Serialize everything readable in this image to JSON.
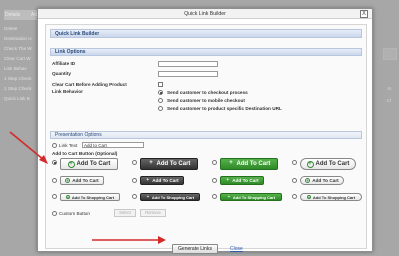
{
  "background": {
    "tabs": [
      "Details",
      "Ad"
    ],
    "sidebar_items": [
      "Delete",
      "Destination U",
      "Check The W",
      "Clear Cart W",
      "Link Behav",
      "1 Step Check",
      "1 Step Check",
      "Quick Link B"
    ],
    "right_links": [
      "st",
      "Cl"
    ]
  },
  "dialog": {
    "title": "Quick Link Builder",
    "close_label": "X",
    "header": "Quick Link Builder",
    "link_options": {
      "heading": "Link Options",
      "affiliate_label": "Affiliate ID",
      "affiliate_value": "",
      "quantity_label": "Quantity",
      "quantity_value": "",
      "clear_cart_label": "Clear Cart Before Adding Product",
      "link_behavior_label": "Link Behavior",
      "behaviors": [
        {
          "label": "Send customer to checkout process",
          "selected": true
        },
        {
          "label": "Send customer to mobile checkout",
          "selected": false
        },
        {
          "label": "Send customer to product specific Destination URL",
          "selected": false
        }
      ]
    },
    "presentation": {
      "heading": "Presentation Options",
      "link_text_label": "Link Text",
      "link_text_value": "Add to Cart",
      "cart_button_label": "Add to Cart Button (Optional)",
      "styles": [
        {
          "label": "Add To Cart",
          "style": "white",
          "size": "lg",
          "selected": true
        },
        {
          "label": "Add To Cart",
          "style": "dark",
          "size": "lg",
          "selected": false
        },
        {
          "label": "Add To Cart",
          "style": "green",
          "size": "lg",
          "selected": false
        },
        {
          "label": "Add To Cart",
          "style": "white pill",
          "size": "lg",
          "selected": false
        },
        {
          "label": "Add To Cart",
          "style": "white",
          "size": "md",
          "selected": false
        },
        {
          "label": "Add To Cart",
          "style": "dark",
          "size": "md",
          "selected": false
        },
        {
          "label": "Add To Cart",
          "style": "green",
          "size": "md",
          "selected": false
        },
        {
          "label": "Add To Cart",
          "style": "white pill",
          "size": "md",
          "selected": false
        },
        {
          "label": "Add To Shopping Cart",
          "style": "white",
          "size": "sm",
          "selected": false
        },
        {
          "label": "Add To Shopping Cart",
          "style": "dark",
          "size": "sm",
          "selected": false
        },
        {
          "label": "Add To Shopping Cart",
          "style": "green",
          "size": "sm",
          "selected": false
        },
        {
          "label": "Add To Shopping Cart",
          "style": "white pill",
          "size": "sm",
          "selected": false
        }
      ],
      "custom_button_label": "Custom Button",
      "select_label": "Select",
      "remove_label": "Remove"
    },
    "generate_label": "Generate Links",
    "close_link_label": "Close"
  },
  "colors": {
    "accent_blue": "#2a4a7a",
    "annotation_red": "#d42a2a",
    "green_button": "#3a9a32"
  }
}
